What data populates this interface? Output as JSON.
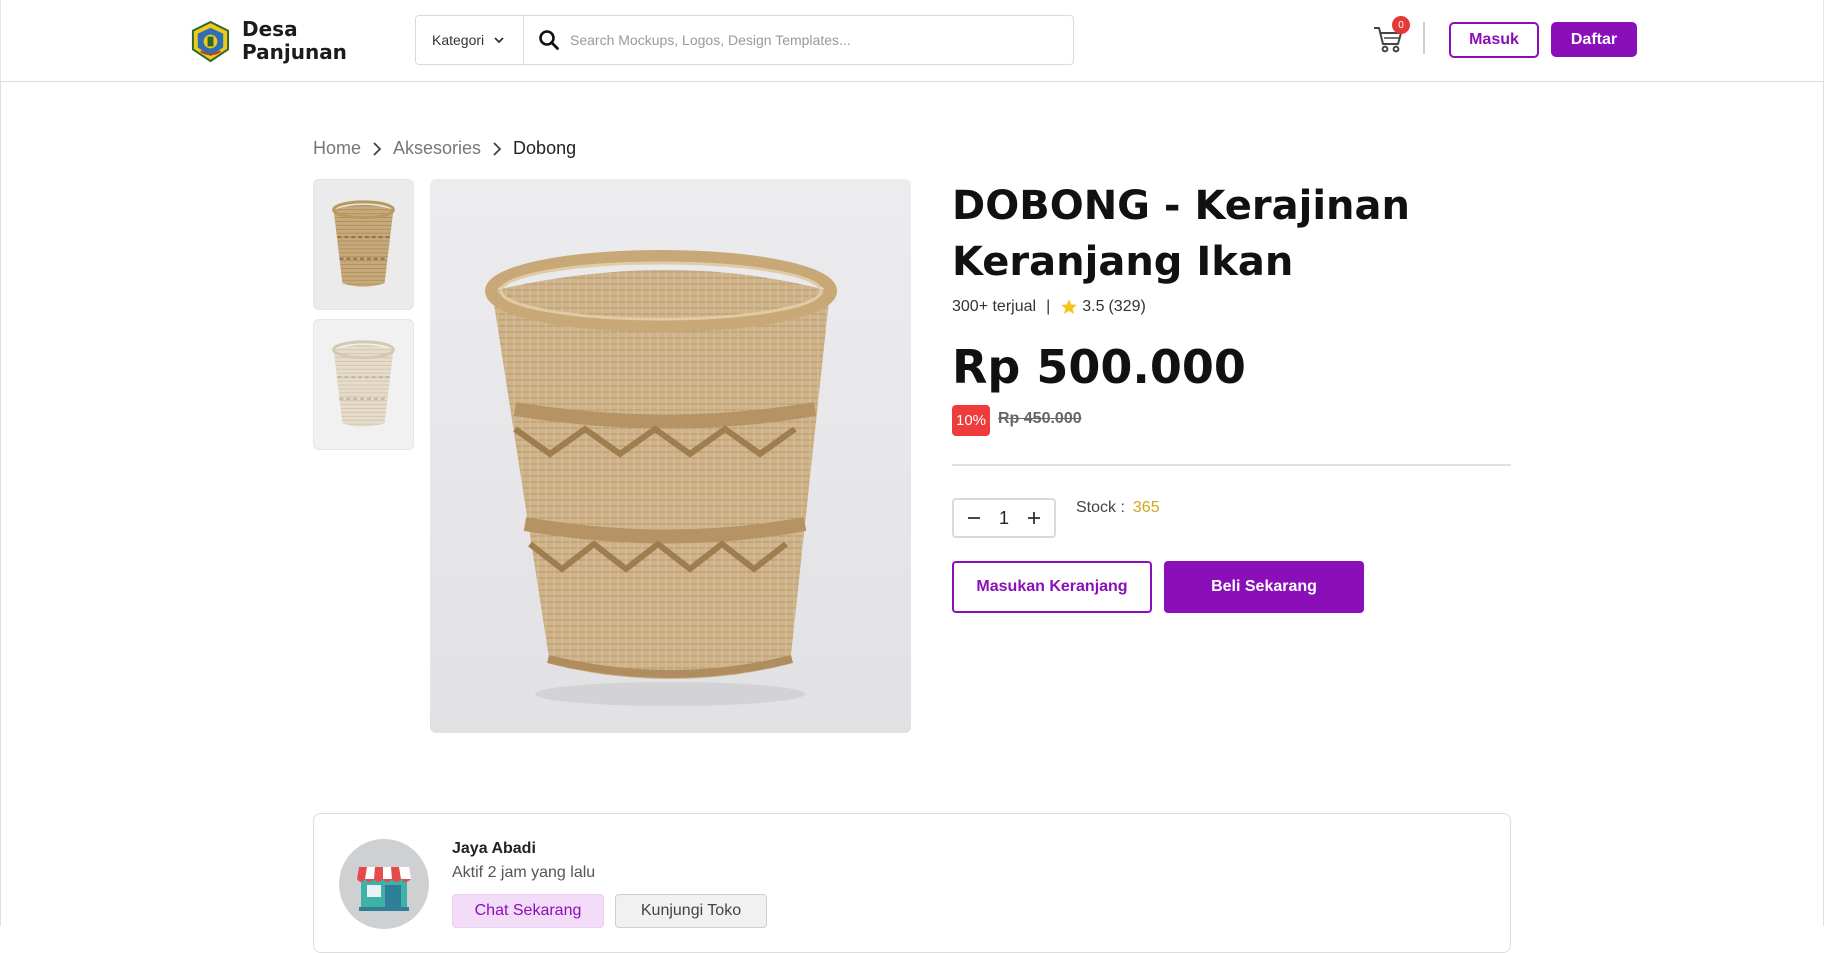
{
  "brand": {
    "name_line1": "Desa",
    "name_line2": "Panjunan",
    "logo_icon": "regency-crest-icon"
  },
  "header": {
    "category_label": "Kategori",
    "search_placeholder": "Search Mockups, Logos, Design Templates...",
    "cart_count": "0",
    "login_label": "Masuk",
    "register_label": "Daftar"
  },
  "breadcrumb": {
    "items": [
      "Home",
      "Aksesories",
      "Dobong"
    ]
  },
  "product": {
    "title": "DOBONG - Kerajinan Keranjang Ikan",
    "sold": "300+ terjual",
    "separator": "|",
    "rating": "3.5",
    "reviews": "(329)",
    "price": "Rp 500.000",
    "discount": "10%",
    "old_price": "Rp 450.000",
    "quantity": "1",
    "stock_label": "Stock :",
    "stock_value": "365",
    "add_to_cart_label": "Masukan Keranjang",
    "buy_now_label": "Beli Sekarang"
  },
  "shop": {
    "name": "Jaya Abadi",
    "active_status": "Aktif 2 jam yang lalu",
    "chat_label": "Chat Sekarang",
    "visit_label": "Kunjungi Toko"
  },
  "colors": {
    "accent": "#8b0fb8",
    "discount": "#ee3b3b",
    "stock": "#d4a51a",
    "rating_star": "#f5c518"
  }
}
